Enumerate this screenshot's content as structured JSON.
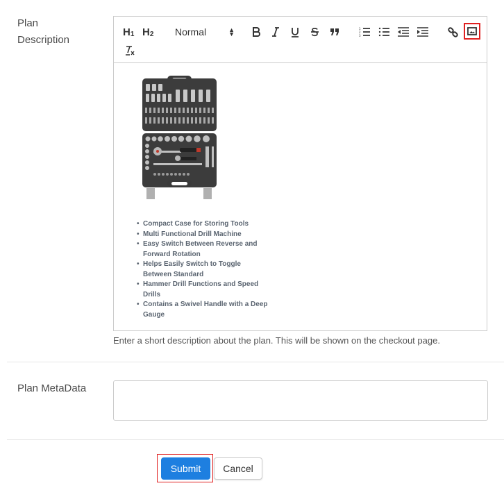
{
  "description_field": {
    "label_line1": "Plan",
    "label_line2": "Description",
    "toolbar": {
      "h1": "H",
      "h1_sub": "1",
      "h2": "H",
      "h2_sub": "2",
      "format_select": "Normal",
      "icons": [
        "heading-1-icon",
        "heading-2-icon",
        "bold-icon",
        "italic-icon",
        "underline-icon",
        "strikethrough-icon",
        "blockquote-icon",
        "ordered-list-icon",
        "bullet-list-icon",
        "outdent-icon",
        "indent-icon",
        "link-icon",
        "image-icon",
        "clear-format-icon"
      ],
      "highlight_color": "#e02020"
    },
    "content": {
      "image_alt": "Socket wrench tool set in black carrying case",
      "features": [
        "Compact Case for Storing Tools",
        "Multi Functional Drill Machine",
        "Easy Switch Between Reverse and Forward Rotation",
        "Helps Easily Switch to Toggle Between Standard",
        "Hammer Drill Functions and Speed Drills",
        "Contains a Swivel Handle with a Deep Gauge"
      ]
    },
    "help_text": "Enter a short description about the plan. This will be shown on the checkout page."
  },
  "metadata_field": {
    "label": "Plan MetaData",
    "value": ""
  },
  "actions": {
    "submit_label": "Submit",
    "cancel_label": "Cancel",
    "submit_color": "#1e7fe0"
  }
}
